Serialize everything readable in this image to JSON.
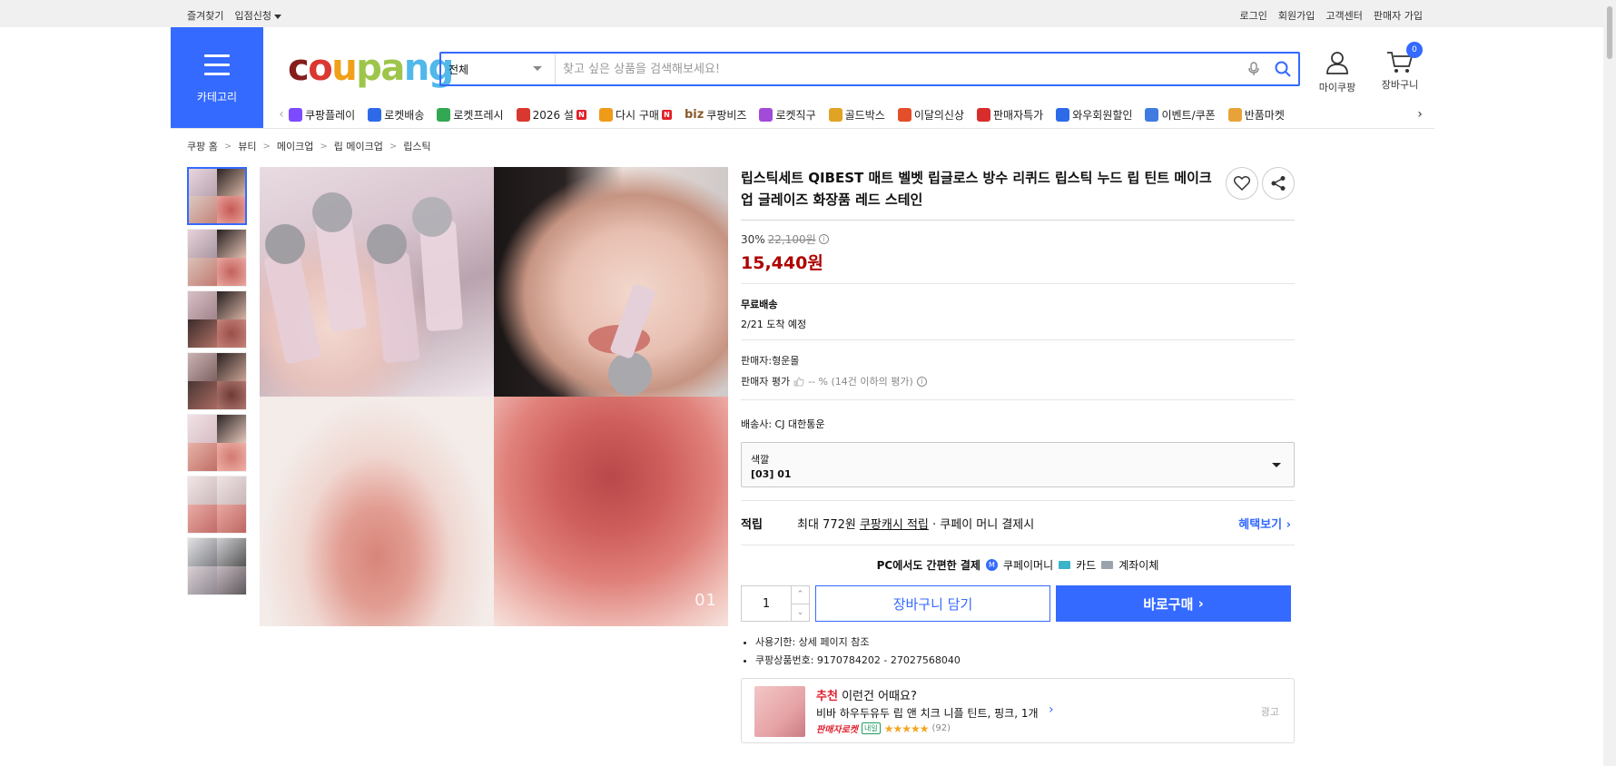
{
  "topbar": {
    "left": [
      "즐겨찾기",
      "입점신청"
    ],
    "right": [
      "로그인",
      "회원가입",
      "고객센터",
      "판매자 가입"
    ]
  },
  "header": {
    "category_label": "카테고리",
    "logo": [
      "c",
      "o",
      "u",
      "pa",
      "ng"
    ],
    "search_scope": "전체",
    "search_placeholder": "찾고 싶은 상품을 검색해보세요!",
    "my_label": "마이쿠팡",
    "cart_label": "장바구니",
    "cart_count": "0"
  },
  "nav": {
    "items": [
      {
        "label": "쿠팡플레이",
        "color": "#7d4bff"
      },
      {
        "label": "로켓배송",
        "color": "#2c6ae8"
      },
      {
        "label": "로켓프레시",
        "color": "#33a852"
      },
      {
        "label": "2026 설",
        "color": "#d93831",
        "n": true
      },
      {
        "label": "다시 구매",
        "color": "#f09a1a",
        "n": true
      },
      {
        "label": "쿠팡비즈",
        "biz": "biz"
      },
      {
        "label": "로켓직구",
        "color": "#a34bd9"
      },
      {
        "label": "골드박스",
        "color": "#e0a323"
      },
      {
        "label": "이달의신상",
        "color": "#e34e2b"
      },
      {
        "label": "판매자특가",
        "color": "#d92c2c"
      },
      {
        "label": "와우회원할인",
        "color": "#2c6ae8"
      },
      {
        "label": "이벤트/쿠폰",
        "color": "#3f7be0"
      },
      {
        "label": "반품마켓",
        "color": "#e7a33a"
      }
    ]
  },
  "breadcrumb": [
    "쿠팡 홈",
    "뷰티",
    "메이크업",
    "립 메이크업",
    "립스틱"
  ],
  "product": {
    "title": "립스틱세트 QIBEST 매트 벨벳 립글로스 방수 리퀴드 립스틱 누드 립 틴트 메이크업 글레이즈 화장품 레드 스테인",
    "discount": "30%",
    "original_price": "22,100원",
    "sale_price": "15,440원",
    "shipping_title": "무료배송",
    "arrival": "2/21 도착 예정",
    "seller": "판매자:형운몰",
    "seller_rating_label": "판매자 평가",
    "seller_rating_value": "-- % (14건 이하의 평가)",
    "carrier": "배송사:  CJ 대한통운",
    "option_label": "색깔",
    "option_value": "[03] 01",
    "reward_key": "적립",
    "reward_text": "최대 772원",
    "reward_link": "쿠팡캐시 적립",
    "reward_suffix": "· 쿠페이 머니 결제시",
    "benefit_link": "혜택보기",
    "pay_title": "PC에서도 간편한 결제",
    "pay_methods": [
      "쿠페이머니",
      "카드",
      "계좌이체"
    ],
    "quantity": "1",
    "cart_button": "장바구니 담기",
    "buy_button": "바로구매",
    "specs": [
      "사용기한: 상세 페이지 참조",
      "쿠팡상품번호: 9170784202 - 27027568040"
    ],
    "image_number": "01"
  },
  "reco": {
    "badge": "추천",
    "title_rest": "이런건 어때요?",
    "name": "비바 하우두유두 립 앤 치크 니플 틴트, 핑크, 1개",
    "rocket": "판매자로켓",
    "tomorrow": "내일",
    "stars": "★★★★★",
    "count": "(92)",
    "ad": "광고"
  },
  "colors": {
    "accent": "#346aff",
    "price": "#ae0000"
  }
}
